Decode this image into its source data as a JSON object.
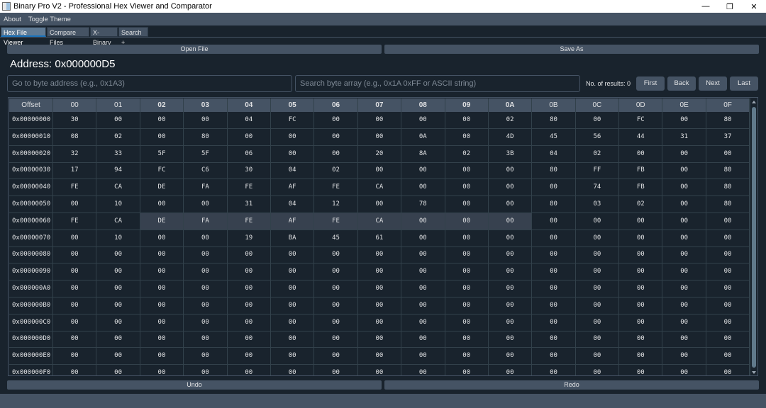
{
  "window": {
    "title": "Binary Pro V2 - Professional Hex Viewer and Comparator",
    "controls": {
      "minimize": "—",
      "maximize": "❐",
      "close": "✕"
    }
  },
  "menu": {
    "items": [
      "About",
      "Toggle Theme"
    ]
  },
  "tabs": [
    {
      "label": "Hex File Viewer",
      "active": true
    },
    {
      "label": "Compare Files",
      "active": false
    },
    {
      "label": "X-Binary",
      "active": false
    },
    {
      "label": "Search +",
      "active": false
    }
  ],
  "toolbar": {
    "open_label": "Open File",
    "save_label": "Save As"
  },
  "address": {
    "label": "Address: 0x000000D5"
  },
  "goto": {
    "placeholder": "Go to byte address (e.g., 0x1A3)"
  },
  "search": {
    "placeholder": "Search byte array (e.g., 0x1A 0xFF or ASCII string)"
  },
  "results": {
    "label": "No. of results: 0"
  },
  "nav": {
    "first": "First",
    "back": "Back",
    "next": "Next",
    "last": "Last"
  },
  "table": {
    "offset_header": "Offset",
    "columns": [
      "00",
      "01",
      "02",
      "03",
      "04",
      "05",
      "06",
      "07",
      "08",
      "09",
      "0A",
      "0B",
      "0C",
      "0D",
      "0E",
      "0F"
    ],
    "rows": [
      {
        "offset": "0x00000000",
        "bytes": [
          "30",
          "00",
          "00",
          "00",
          "04",
          "FC",
          "00",
          "00",
          "00",
          "00",
          "02",
          "80",
          "00",
          "FC",
          "00",
          "80"
        ]
      },
      {
        "offset": "0x00000010",
        "bytes": [
          "08",
          "02",
          "00",
          "80",
          "00",
          "00",
          "00",
          "00",
          "0A",
          "00",
          "4D",
          "45",
          "56",
          "44",
          "31",
          "37"
        ]
      },
      {
        "offset": "0x00000020",
        "bytes": [
          "32",
          "33",
          "5F",
          "5F",
          "06",
          "00",
          "00",
          "20",
          "8A",
          "02",
          "3B",
          "04",
          "02",
          "00",
          "00",
          "00"
        ]
      },
      {
        "offset": "0x00000030",
        "bytes": [
          "17",
          "94",
          "FC",
          "C6",
          "30",
          "04",
          "02",
          "00",
          "00",
          "00",
          "00",
          "80",
          "FF",
          "FB",
          "00",
          "80"
        ]
      },
      {
        "offset": "0x00000040",
        "bytes": [
          "FE",
          "CA",
          "DE",
          "FA",
          "FE",
          "AF",
          "FE",
          "CA",
          "00",
          "00",
          "00",
          "00",
          "74",
          "FB",
          "00",
          "80"
        ]
      },
      {
        "offset": "0x00000050",
        "bytes": [
          "00",
          "10",
          "00",
          "00",
          "31",
          "04",
          "12",
          "00",
          "78",
          "00",
          "00",
          "80",
          "03",
          "02",
          "00",
          "80"
        ]
      },
      {
        "offset": "0x00000060",
        "bytes": [
          "FE",
          "CA",
          "DE",
          "FA",
          "FE",
          "AF",
          "FE",
          "CA",
          "00",
          "00",
          "00",
          "00",
          "00",
          "00",
          "00",
          "00"
        ]
      },
      {
        "offset": "0x00000070",
        "bytes": [
          "00",
          "10",
          "00",
          "00",
          "19",
          "BA",
          "45",
          "61",
          "00",
          "00",
          "00",
          "00",
          "00",
          "00",
          "00",
          "00"
        ]
      },
      {
        "offset": "0x00000080",
        "bytes": [
          "00",
          "00",
          "00",
          "00",
          "00",
          "00",
          "00",
          "00",
          "00",
          "00",
          "00",
          "00",
          "00",
          "00",
          "00",
          "00"
        ]
      },
      {
        "offset": "0x00000090",
        "bytes": [
          "00",
          "00",
          "00",
          "00",
          "00",
          "00",
          "00",
          "00",
          "00",
          "00",
          "00",
          "00",
          "00",
          "00",
          "00",
          "00"
        ]
      },
      {
        "offset": "0x000000A0",
        "bytes": [
          "00",
          "00",
          "00",
          "00",
          "00",
          "00",
          "00",
          "00",
          "00",
          "00",
          "00",
          "00",
          "00",
          "00",
          "00",
          "00"
        ]
      },
      {
        "offset": "0x000000B0",
        "bytes": [
          "00",
          "00",
          "00",
          "00",
          "00",
          "00",
          "00",
          "00",
          "00",
          "00",
          "00",
          "00",
          "00",
          "00",
          "00",
          "00"
        ]
      },
      {
        "offset": "0x000000C0",
        "bytes": [
          "00",
          "00",
          "00",
          "00",
          "00",
          "00",
          "00",
          "00",
          "00",
          "00",
          "00",
          "00",
          "00",
          "00",
          "00",
          "00"
        ]
      },
      {
        "offset": "0x000000D0",
        "bytes": [
          "00",
          "00",
          "00",
          "00",
          "00",
          "00",
          "00",
          "00",
          "00",
          "00",
          "00",
          "00",
          "00",
          "00",
          "00",
          "00"
        ]
      },
      {
        "offset": "0x000000E0",
        "bytes": [
          "00",
          "00",
          "00",
          "00",
          "00",
          "00",
          "00",
          "00",
          "00",
          "00",
          "00",
          "00",
          "00",
          "00",
          "00",
          "00"
        ]
      },
      {
        "offset": "0x000000F0",
        "bytes": [
          "00",
          "00",
          "00",
          "00",
          "00",
          "00",
          "00",
          "00",
          "00",
          "00",
          "00",
          "00",
          "00",
          "00",
          "00",
          "00"
        ]
      }
    ]
  },
  "bottom": {
    "undo_label": "Undo",
    "redo_label": "Redo"
  }
}
